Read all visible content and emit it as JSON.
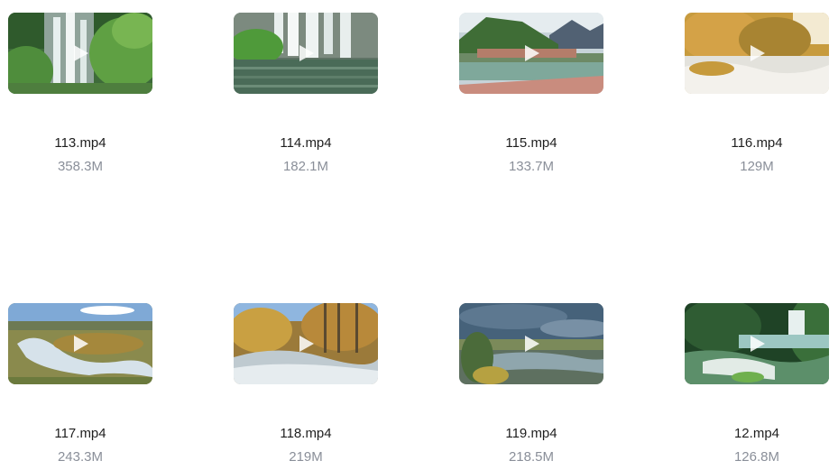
{
  "videos": [
    {
      "name": "113.mp4",
      "size": "358.3M",
      "icon": "play-icon"
    },
    {
      "name": "114.mp4",
      "size": "182.1M",
      "icon": "play-icon"
    },
    {
      "name": "115.mp4",
      "size": "133.7M",
      "icon": "play-icon"
    },
    {
      "name": "116.mp4",
      "size": "129M",
      "icon": "play-icon"
    },
    {
      "name": "117.mp4",
      "size": "243.3M",
      "icon": "play-icon"
    },
    {
      "name": "118.mp4",
      "size": "219M",
      "icon": "play-icon"
    },
    {
      "name": "119.mp4",
      "size": "218.5M",
      "icon": "play-icon"
    },
    {
      "name": "12.mp4",
      "size": "126.8M",
      "icon": "play-icon"
    }
  ],
  "colors": {
    "filename": "#1f1f1f",
    "filesize": "#8a8f99",
    "play_overlay": "#ffffff"
  }
}
